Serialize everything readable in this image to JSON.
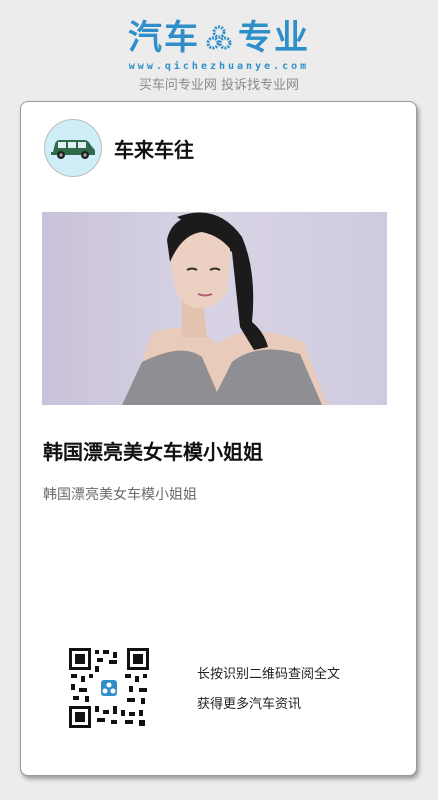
{
  "brand": {
    "title_left": "汽车",
    "title_right": "专业",
    "url": "www.qichezhuanye.com",
    "slogan": "买车问专业网 投诉找专业网",
    "color": "#2f8fc9"
  },
  "author": {
    "name": "车来车往",
    "avatar_icon": "car-icon"
  },
  "article": {
    "title": "韩国漂亮美女车模小姐姐",
    "summary": "韩国漂亮美女车模小姐姐"
  },
  "qr": {
    "line1": "长按识别二维码查阅全文",
    "line2": "获得更多汽车资讯",
    "center_icon": "brand-logo-icon"
  }
}
